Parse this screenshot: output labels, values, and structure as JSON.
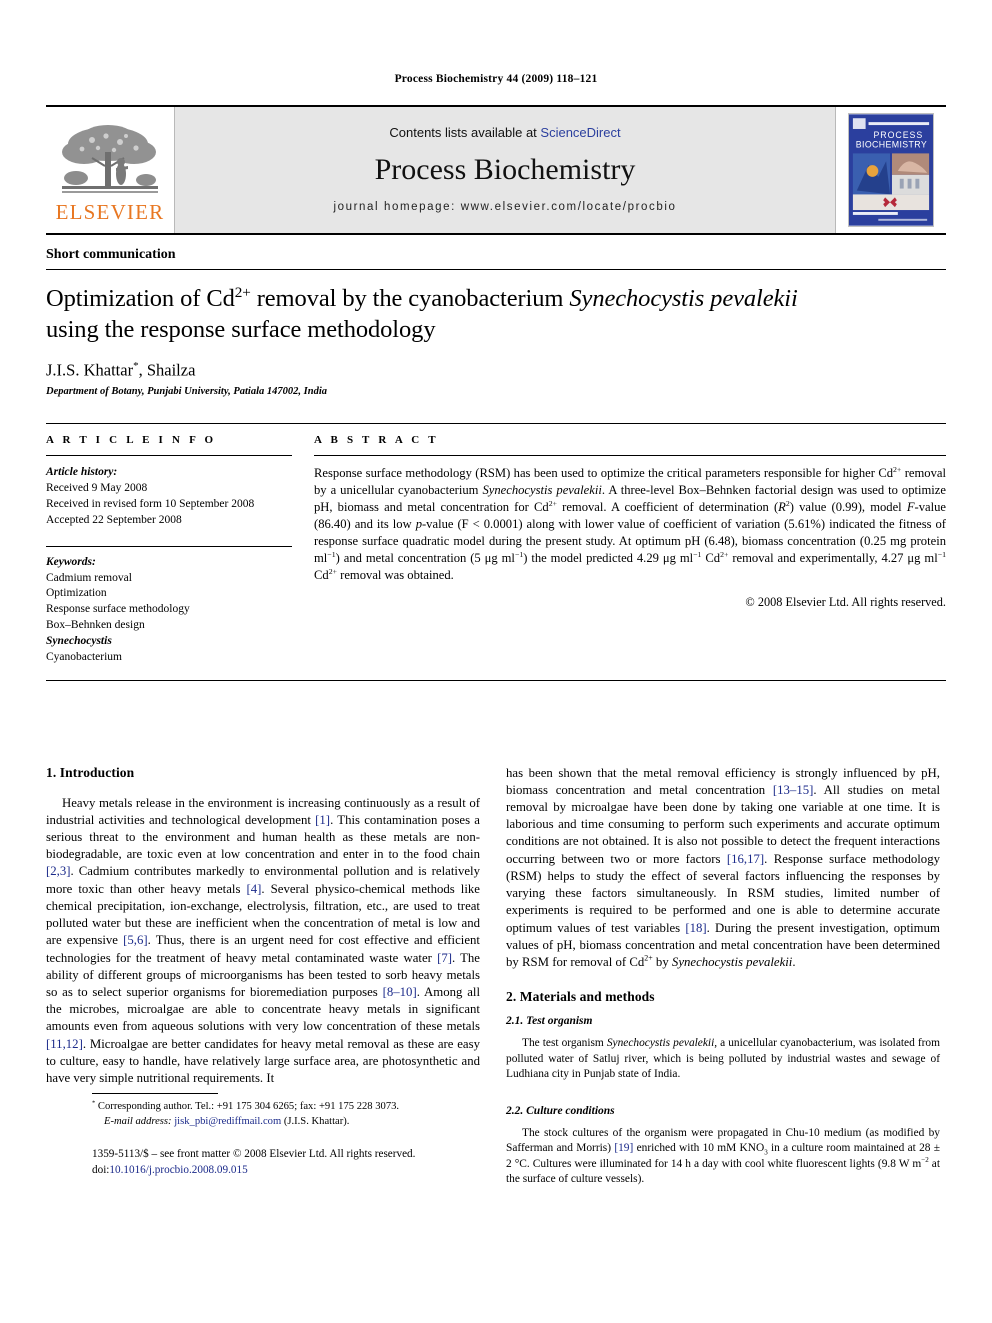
{
  "running_head": "Process Biochemistry 44 (2009) 118–121",
  "masthead": {
    "publisher_logo_text": "ELSEVIER",
    "contents_prefix": "Contents lists available at ",
    "contents_link": "ScienceDirect",
    "journal_name": "Process Biochemistry",
    "homepage": "journal homepage: www.elsevier.com/locate/procbio",
    "cover_title_line1": "PROCESS",
    "cover_title_line2": "BIOCHEMISTRY"
  },
  "article": {
    "type": "Short communication",
    "title_part1": "Optimization of Cd",
    "title_sup1": "2+",
    "title_part2": " removal by the cyanobacterium ",
    "title_italic": "Synechocystis pevalekii",
    "title_part3": "using the response surface methodology",
    "authors": "J.I.S. Khattar",
    "authors_second": ", Shailza",
    "author_marker": "*",
    "affiliation": "Department of Botany, Punjabi University, Patiala 147002, India"
  },
  "info": {
    "label": "A R T I C L E    I N F O",
    "history_head": "Article history:",
    "history": [
      "Received 9 May 2008",
      "Received in revised form 10 September 2008",
      "Accepted 22 September 2008"
    ],
    "keywords_head": "Keywords:",
    "keywords": [
      "Cadmium removal",
      "Optimization",
      "Response surface methodology",
      "Box–Behnken design",
      "Synechocystis",
      "Cyanobacterium"
    ],
    "keywords_italic_index": 4
  },
  "abstract": {
    "label": "A B S T R A C T",
    "t1": "Response surface methodology (RSM) has been used to optimize the critical parameters responsible for higher Cd",
    "s1": "2+",
    "t2": " removal by a unicellular cyanobacterium ",
    "i1": "Synechocystis pevalekii",
    "t3": ". A three-level Box–Behnken factorial design was used to optimize pH, biomass and metal concentration for Cd",
    "s2": "2+",
    "t4": " removal. A coefficient of determination (",
    "i2": "R",
    "s3": "2",
    "t5": ") value (0.99), model ",
    "i3": "F",
    "t6": "-value (86.40) and its low ",
    "i4": "p",
    "t7": "-value (F < 0.0001) along with lower value of coefficient of variation (5.61%) indicated the fitness of response surface quadratic model during the present study. At optimum pH (6.48), biomass concentration (0.25 mg protein ml",
    "s4": "−1",
    "t8": ") and metal concentration (5 μg ml",
    "s5": "−1",
    "t9": ") the model predicted 4.29 μg ml",
    "s6": "−1",
    "t10": " Cd",
    "s7": "2+",
    "t11": " removal and experimentally, 4.27 μg ml",
    "s8": "−1",
    "t12": " Cd",
    "s9": "2+",
    "t13": " removal was obtained.",
    "copyright": "© 2008 Elsevier Ltd. All rights reserved."
  },
  "sections": {
    "introduction_heading": "1. Introduction",
    "intro_p1_a": "Heavy metals release in the environment is increasing continuously as a result of industrial activities and technological development ",
    "intro_r1": "[1]",
    "intro_p1_b": ". This contamination poses a serious threat to the environment and human health as these metals are non-biodegradable, are toxic even at low concentration and enter in to the food chain ",
    "intro_r2": "[2,3]",
    "intro_p1_c": ". Cadmium contributes markedly to environmental pollution and is relatively more toxic than other heavy metals ",
    "intro_r3": "[4]",
    "intro_p1_d": ". Several physico-chemical methods like chemical precipitation, ion-exchange, electrolysis, filtration, etc., are used to treat polluted water but these are inefficient when the concentration of metal is low and are expensive ",
    "intro_r4": "[5,6]",
    "intro_p1_e": ". Thus, there is an urgent need for cost effective and efficient technologies for the treatment of heavy metal contaminated waste water ",
    "intro_r5": "[7]",
    "intro_p1_f": ". The ability of different groups of microorganisms has been tested to sorb heavy metals so as to select superior organisms for bioremediation purposes ",
    "intro_r6": "[8–10]",
    "intro_p1_g": ". Among all the microbes, microalgae are able to concentrate heavy metals in significant amounts even from aqueous solutions with very low concentration of these metals ",
    "intro_r7": "[11,12]",
    "intro_p1_h": ". Microalgae are better candidates for heavy metal removal as these are easy to culture, easy to handle, have relatively large surface area, are photosynthetic and have very simple nutritional requirements. It",
    "intro_cont_a": "has been shown that the metal removal efficiency is strongly influenced by pH, biomass concentration and metal concentration ",
    "intro_r8": "[13–15]",
    "intro_cont_b": ". All studies on metal removal by microalgae have been done by taking one variable at one time. It is laborious and time consuming to perform such experiments and accurate optimum conditions are not obtained. It is also not possible to detect the frequent interactions occurring between two or more factors ",
    "intro_r9": "[16,17]",
    "intro_cont_c": ". Response surface methodology (RSM) helps to study the effect of several factors influencing the responses by varying these factors simultaneously. In RSM studies, limited number of experiments is required to be performed and one is able to determine accurate optimum values of test variables ",
    "intro_r10": "[18]",
    "intro_cont_d": ". During the present investigation, optimum values of pH, biomass concentration and metal concentration have been determined by RSM for removal of Cd",
    "intro_sup": "2+",
    "intro_cont_e": " by ",
    "intro_italic": "Synechocystis pevalekii",
    "intro_cont_f": ".",
    "methods_heading": "2. Materials and methods",
    "sub1_heading": "2.1. Test organism",
    "sub1_a": "The test organism ",
    "sub1_i": "Synechocystis pevalekii",
    "sub1_b": ", a unicellular cyanobacterium, was isolated from polluted water of Satluj river, which is being polluted by industrial wastes and sewage of Ludhiana city in Punjab state of India.",
    "sub2_heading": "2.2. Culture conditions",
    "sub2_a": "The stock cultures of the organism were propagated in Chu-10 medium (as modified by Safferman and Morris) ",
    "sub2_r": "[19]",
    "sub2_b": " enriched with 10 mM KNO",
    "sub2_sub": "3",
    "sub2_c": " in a culture room maintained at 28 ± 2 °C. Cultures were illuminated for 14 h a day with cool white fluorescent lights (9.8 W m",
    "sub2_sup": "−2",
    "sub2_d": " at the surface of culture vessels)."
  },
  "footnote": {
    "marker": "*",
    "corresponding": " Corresponding author. Tel.: +91 175 304 6265; fax: +91 175 228 3073.",
    "email_label": "E-mail address:",
    "email": "jisk_pbi@rediffmail.com",
    "email_owner": " (J.I.S. Khattar)."
  },
  "copyline": {
    "issn_line": "1359-5113/$ – see front matter © 2008 Elsevier Ltd. All rights reserved.",
    "doi_label": "doi:",
    "doi": "10.1016/j.procbio.2008.09.015"
  },
  "colors": {
    "elsevier_orange": "#E87722",
    "reference_blue": "#1b2a8a",
    "link_blue": "#2b3f9e",
    "masthead_grey": "#e6e6e6",
    "cover_navy": "#1d3a8f"
  }
}
